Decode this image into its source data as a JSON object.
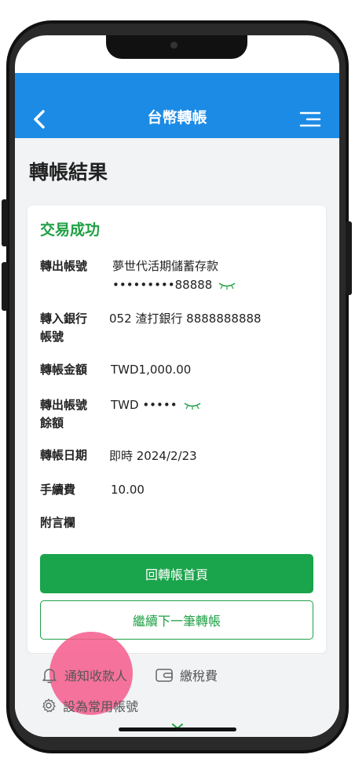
{
  "header": {
    "title": "台幣轉帳"
  },
  "page_title": "轉帳結果",
  "result": {
    "status": "交易成功",
    "rows": [
      {
        "label": "轉出帳號",
        "value_line1": "夢世代活期儲蓄存款",
        "value_line2": "•••••••••88888"
      },
      {
        "label_line1": "轉入銀行",
        "label_line2": "帳號",
        "value": "052 渣打銀行 8888888888"
      },
      {
        "label": "轉帳金額",
        "value": "TWD1,000.00"
      },
      {
        "label_line1": "轉出帳號",
        "label_line2": "餘額",
        "value": "TWD •••••"
      },
      {
        "label": "轉帳日期",
        "value": "即時 2024/2/23"
      },
      {
        "label": "手續費",
        "value": "10.00"
      },
      {
        "label": "附言欄",
        "value": ""
      }
    ]
  },
  "buttons": {
    "back_home": "回轉帳首頁",
    "continue": "繼續下一筆轉帳"
  },
  "actions": {
    "notify": "通知收款人",
    "tax": "繳稅費",
    "common_account": "設為常用帳號"
  },
  "colors": {
    "header": "#1b8be6",
    "success": "#1fa045",
    "primary_button": "#1aa44b",
    "touch_indicator": "#f65a8c"
  },
  "icons": [
    "back-icon",
    "menu-icon",
    "eye-icon",
    "bell-icon",
    "wallet-icon",
    "gear-icon",
    "chevron-down-icon"
  ]
}
